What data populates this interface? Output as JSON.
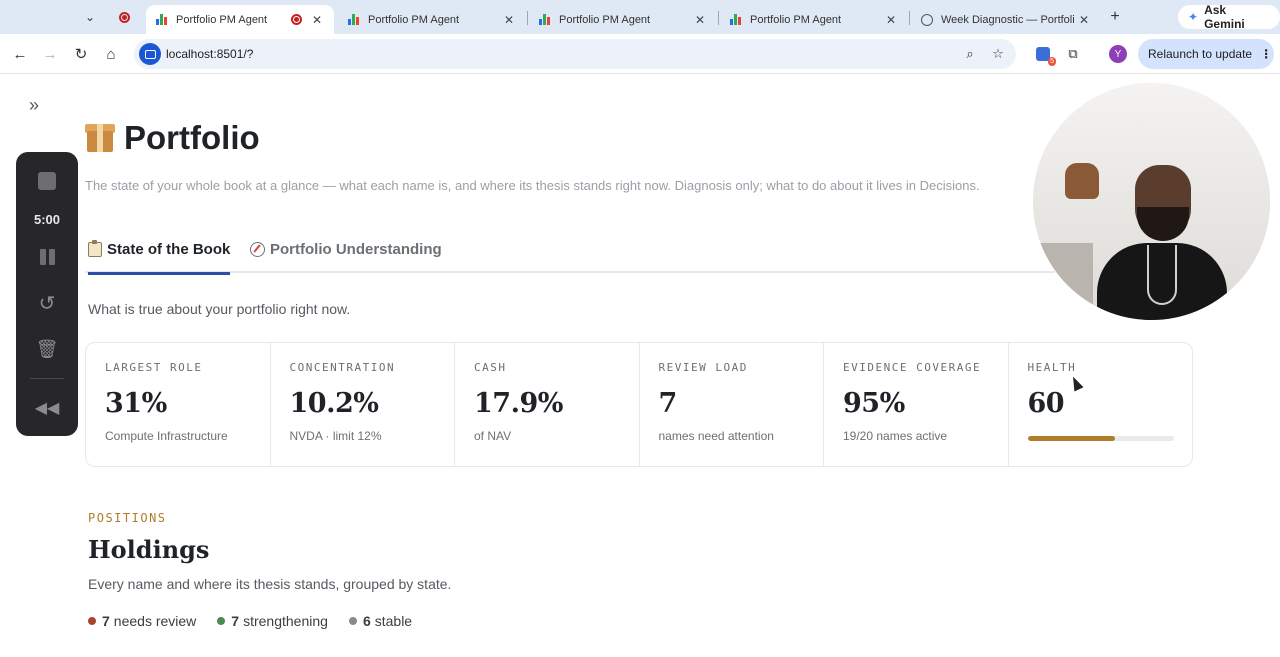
{
  "browser": {
    "tabs": [
      {
        "title": "Portfolio PM Agent",
        "active": true,
        "recording": true
      },
      {
        "title": "Portfolio PM Agent",
        "active": false
      },
      {
        "title": "Portfolio PM Agent",
        "active": false
      },
      {
        "title": "Portfolio PM Agent",
        "active": false
      },
      {
        "title": "Week Diagnostic — Portfoli",
        "active": false
      }
    ],
    "ask_gemini": "Ask Gemini",
    "url": "localhost:8501/?",
    "relaunch": "Relaunch to update",
    "profile_initial": "Y",
    "extension_badge": "5"
  },
  "recorder": {
    "time": "5:00"
  },
  "page": {
    "title": "Portfolio",
    "subtitle": "The state of your whole book at a glance — what each name is, and where its thesis stands right now. Diagnosis only; what to do about it lives in Decisions.",
    "tabs": [
      {
        "label": "State of the Book",
        "icon": "clipboard-icon",
        "active": true
      },
      {
        "label": "Portfolio Understanding",
        "icon": "compass-icon",
        "active": false
      }
    ],
    "intro": "What is true about your portfolio right now.",
    "metrics": [
      {
        "label": "LARGEST ROLE",
        "value": "31%",
        "sub": "Compute Infrastructure"
      },
      {
        "label": "CONCENTRATION",
        "value": "10.2%",
        "sub": "NVDA · limit 12%"
      },
      {
        "label": "CASH",
        "value": "17.9%",
        "sub": "of NAV"
      },
      {
        "label": "REVIEW LOAD",
        "value": "7",
        "sub": "names need attention"
      },
      {
        "label": "EVIDENCE COVERAGE",
        "value": "95%",
        "sub": "19/20 names active"
      },
      {
        "label": "HEALTH",
        "value": "60",
        "progress": 0.6
      }
    ],
    "positions": {
      "eyebrow": "POSITIONS",
      "title": "Holdings",
      "subtitle": "Every name and where its thesis stands, grouped by state.",
      "states": [
        {
          "count": "7",
          "label": "needs review",
          "color": "#a8432c"
        },
        {
          "count": "7",
          "label": "strengthening",
          "color": "#4a8a4a"
        },
        {
          "count": "6",
          "label": "stable",
          "color": "#8a8a8a"
        }
      ]
    }
  },
  "colors": {
    "accent_tab": "#2b4fa8",
    "eyebrow": "#b07d2a",
    "health_fill": "#b07d2a"
  }
}
